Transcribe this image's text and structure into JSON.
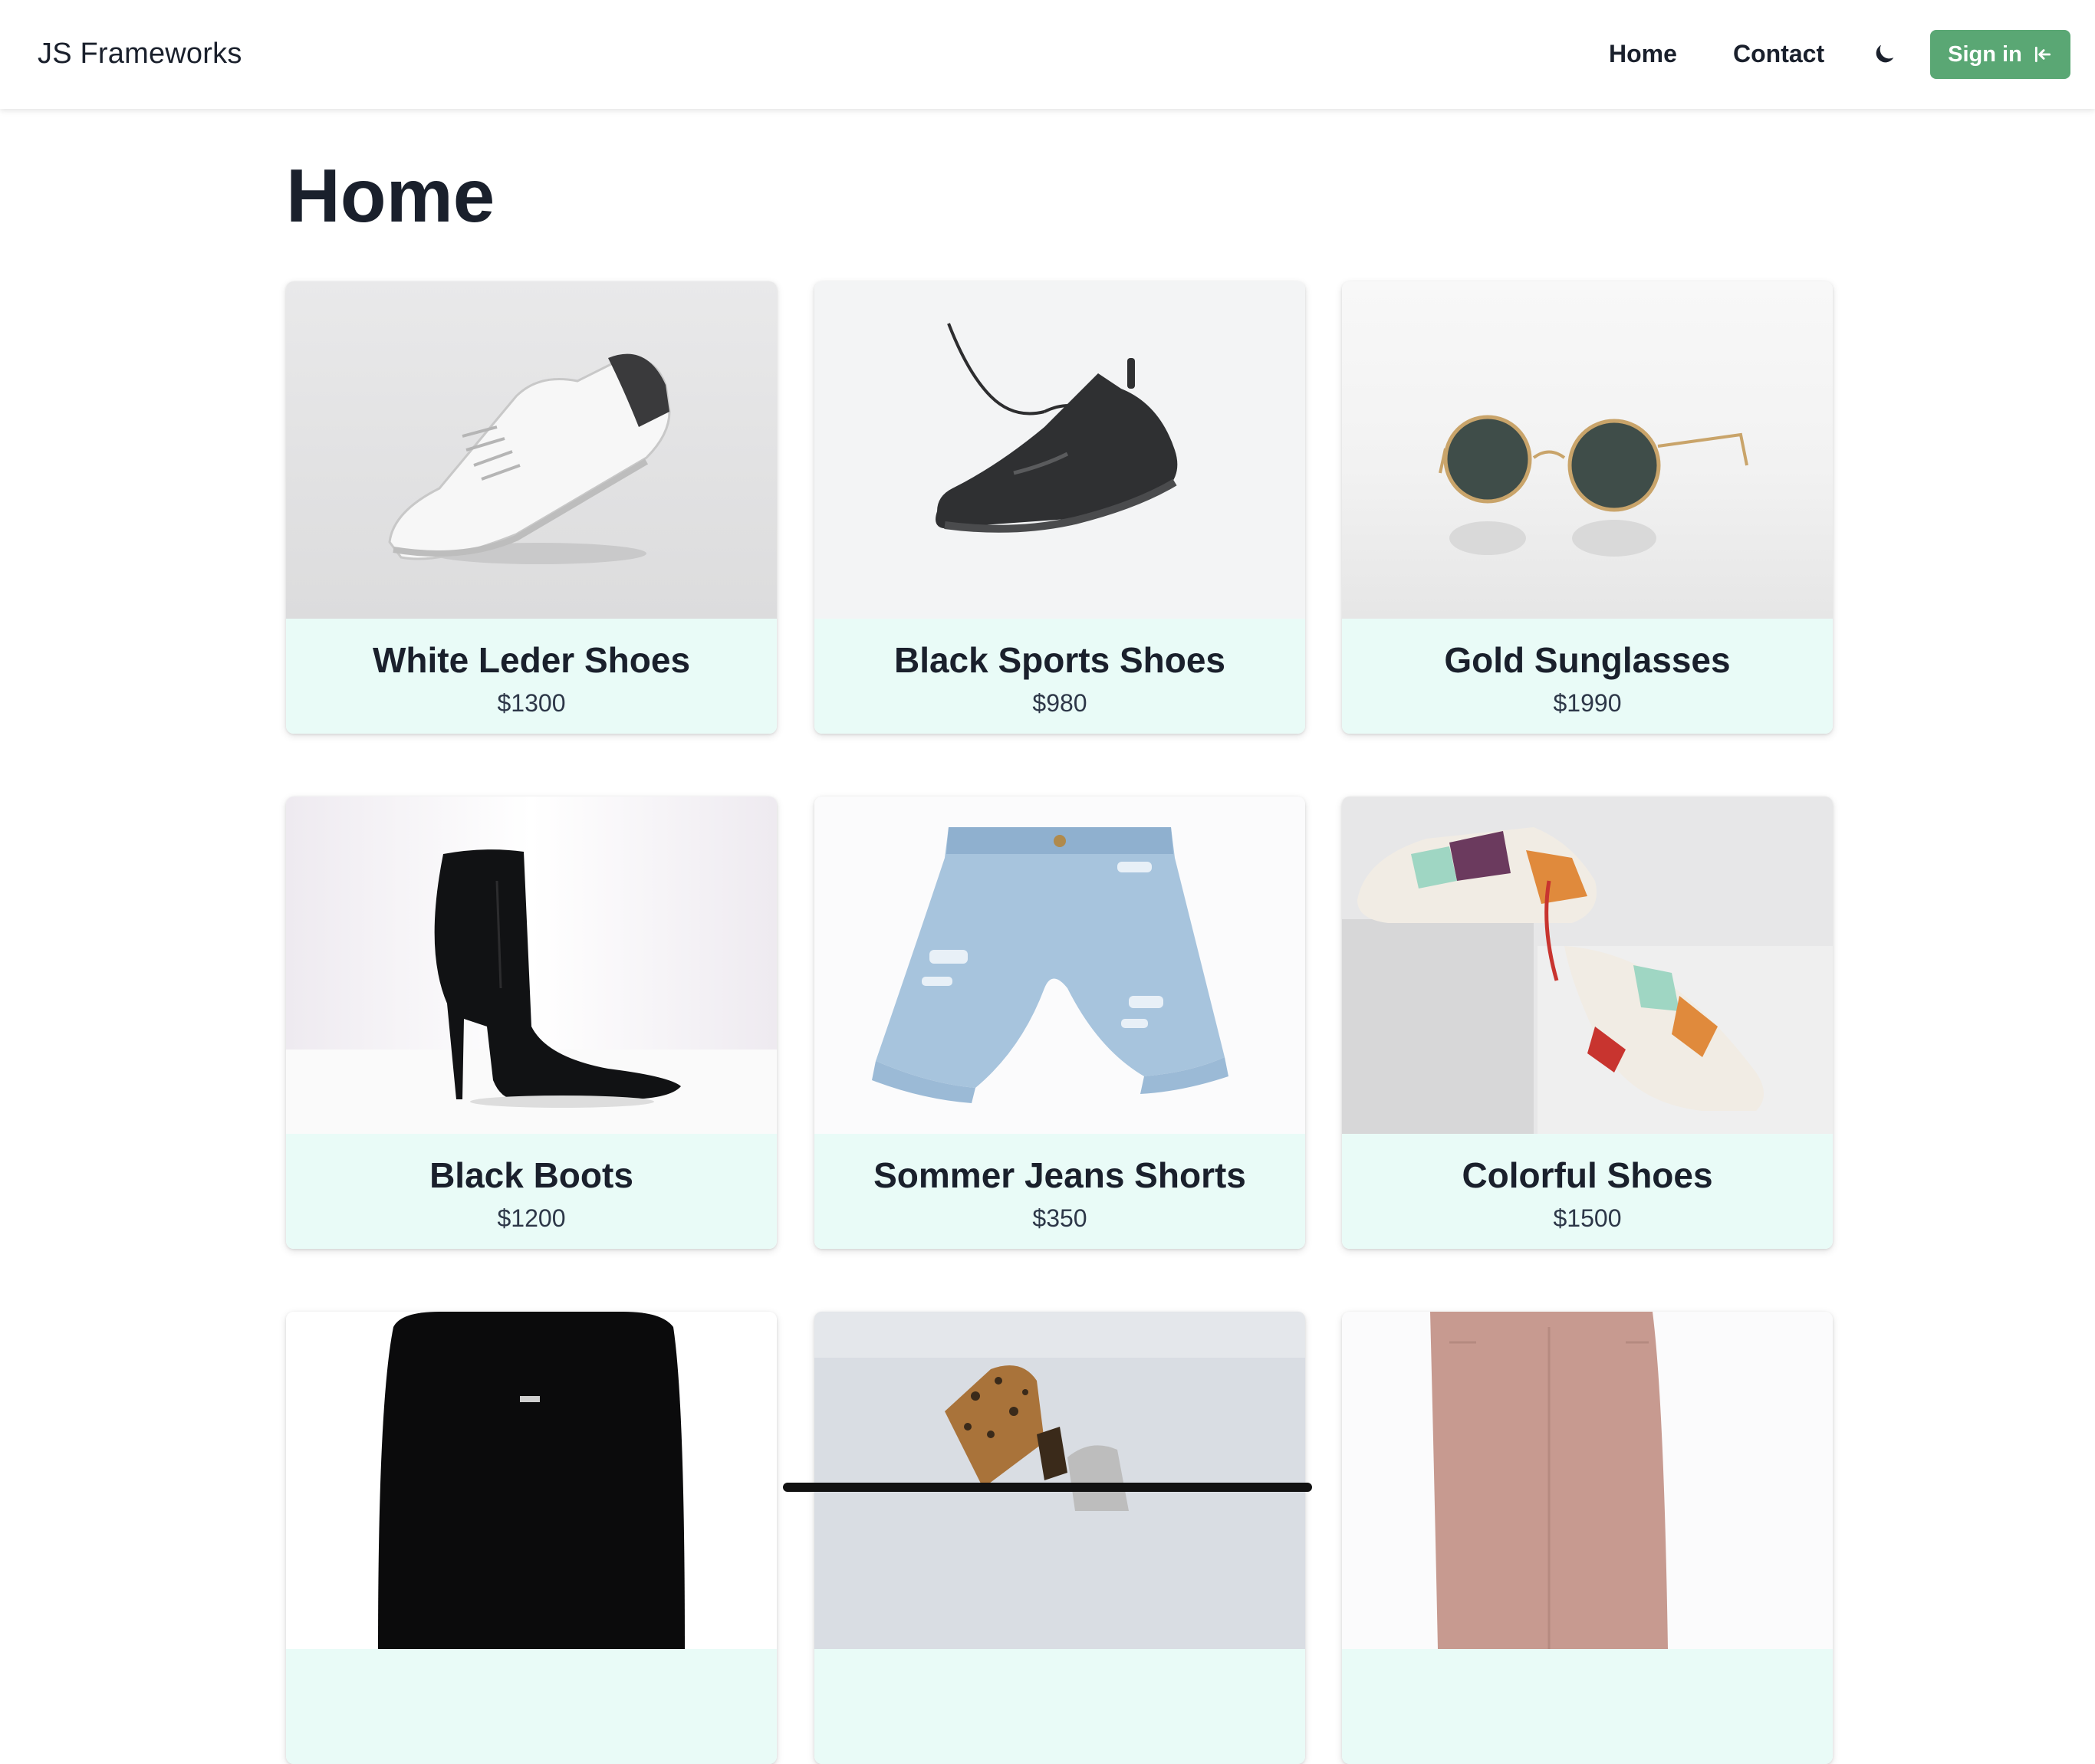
{
  "navbar": {
    "brand": "JS Frameworks",
    "links": [
      {
        "label": "Home"
      },
      {
        "label": "Contact"
      }
    ],
    "theme_icon": "moon-icon",
    "signin": {
      "label": "Sign in",
      "icon": "login-arrow-icon"
    }
  },
  "page": {
    "title": "Home"
  },
  "products": [
    {
      "name": "White Leder Shoes",
      "price": "$1300"
    },
    {
      "name": "Black Sports Shoes",
      "price": "$980"
    },
    {
      "name": "Gold Sunglasses",
      "price": "$1990"
    },
    {
      "name": "Black Boots",
      "price": "$1200"
    },
    {
      "name": "Sommer Jeans Shorts",
      "price": "$350"
    },
    {
      "name": "Colorful Shoes",
      "price": "$1500"
    },
    {
      "name": "",
      "price": ""
    },
    {
      "name": "",
      "price": ""
    },
    {
      "name": "",
      "price": ""
    }
  ],
  "colors": {
    "accent": "#5aa774",
    "card_body": "#e9fbf7",
    "text": "#1a202c"
  }
}
